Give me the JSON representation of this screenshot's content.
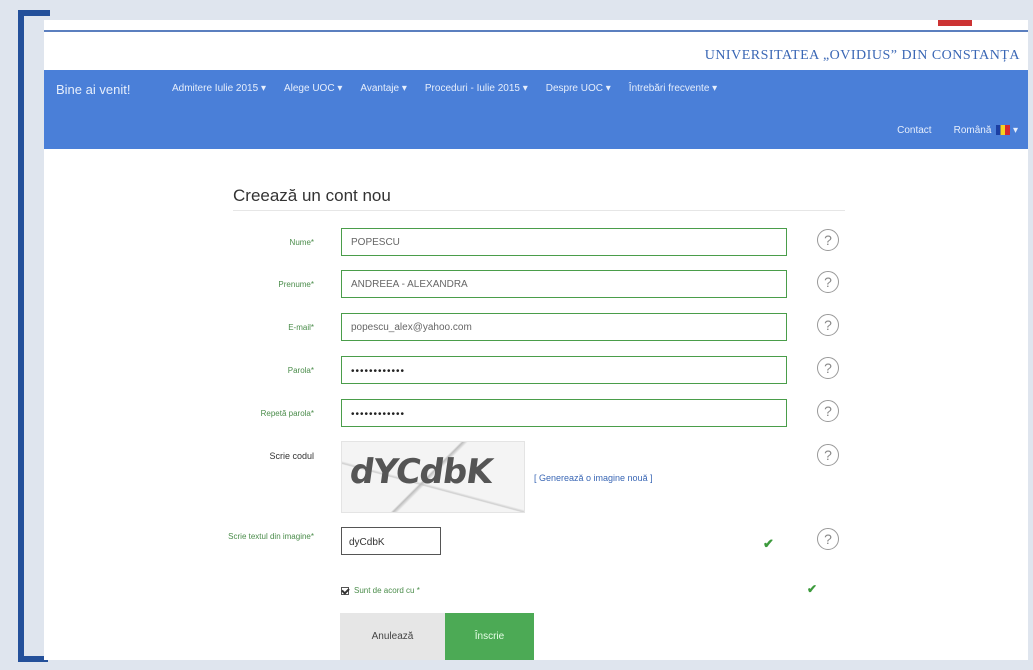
{
  "header": {
    "university": "UNIVERSITATEA „OVIDIUS” DIN CONSTANȚA"
  },
  "navbar": {
    "brand": "Bine ai venit!",
    "items": [
      {
        "label": "Admitere Iulie 2015 ▾"
      },
      {
        "label": "Alege UOC ▾"
      },
      {
        "label": "Avantaje ▾"
      },
      {
        "label": "Proceduri - Iulie 2015 ▾"
      },
      {
        "label": "Despre UOC ▾"
      },
      {
        "label": "Întrebări frecvente ▾"
      }
    ],
    "contact": "Contact",
    "language": "Română",
    "language_caret": "▾"
  },
  "form": {
    "title": "Creează un cont nou",
    "fields": [
      {
        "label": "Nume*",
        "value": "POPESCU",
        "type": "text"
      },
      {
        "label": "Prenume*",
        "value": "ANDREEA - ALEXANDRA",
        "type": "text"
      },
      {
        "label": "E-mail*",
        "value": "popescu_alex@yahoo.com",
        "type": "text"
      },
      {
        "label": "Parola*",
        "value": "••••••••••••",
        "type": "password"
      },
      {
        "label": "Repetă parola*",
        "value": "••••••••••••",
        "type": "password"
      }
    ],
    "captcha_label": "Scrie codul",
    "captcha_image_text": "dYCdbK",
    "regenerate": "[ Generează o imagine nouă ]",
    "captcha_input_label": "Scrie textul din imagine*",
    "captcha_input_value": "dyCdbK",
    "agree_label": "Sunt de acord cu *",
    "cancel": "Anulează",
    "submit": "Înscrie"
  },
  "icons": {
    "check": "✔",
    "help": "?"
  },
  "colors": {
    "navbar": "#4a7fd8",
    "valid": "#4a9d4a",
    "submit": "#4caa55",
    "frame": "#24509a"
  }
}
